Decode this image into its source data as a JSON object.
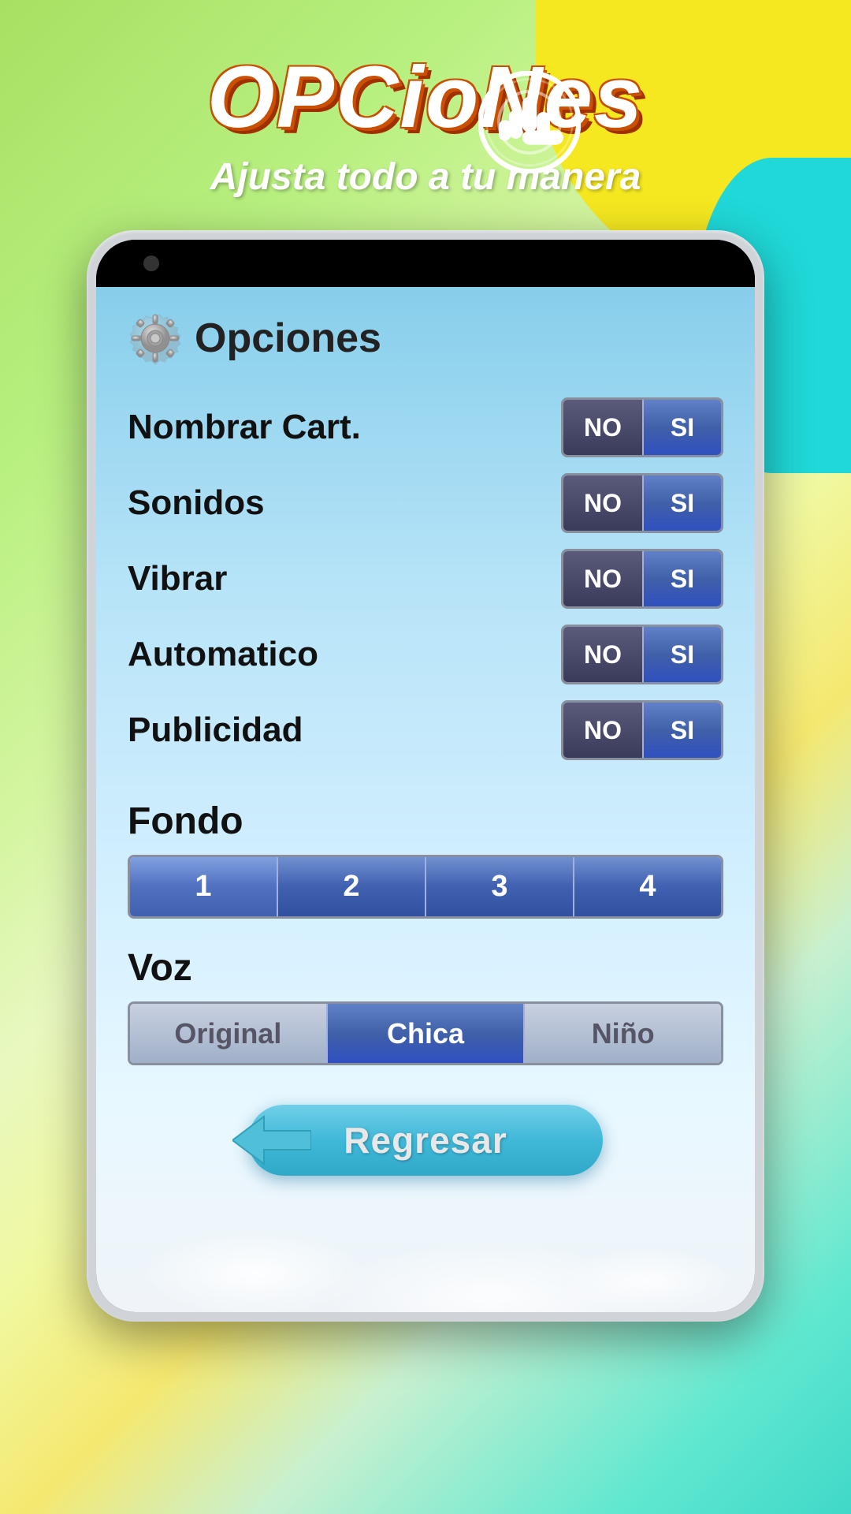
{
  "page": {
    "background": {
      "gradient_start": "#a8e063",
      "gradient_end": "#40d8c8"
    }
  },
  "header": {
    "title": "OPCioNes",
    "subtitle": "Ajusta todo a tu manera",
    "hand_icon_label": "tap-hand"
  },
  "screen": {
    "title": "Opciones",
    "gear_icon": "gear-icon",
    "options": [
      {
        "id": "nombrar_cart",
        "label": "Nombrar Cart.",
        "no_label": "NO",
        "si_label": "SI",
        "selected": "SI"
      },
      {
        "id": "sonidos",
        "label": "Sonidos",
        "no_label": "NO",
        "si_label": "SI",
        "selected": "SI"
      },
      {
        "id": "vibrar",
        "label": "Vibrar",
        "no_label": "NO",
        "si_label": "SI",
        "selected": "SI"
      },
      {
        "id": "automatico",
        "label": "Automatico",
        "no_label": "NO",
        "si_label": "SI",
        "selected": "SI"
      },
      {
        "id": "publicidad",
        "label": "Publicidad",
        "no_label": "NO",
        "si_label": "SI",
        "selected": "SI"
      }
    ],
    "fondo": {
      "label": "Fondo",
      "buttons": [
        "1",
        "2",
        "3",
        "4"
      ],
      "active_index": 0
    },
    "voz": {
      "label": "Voz",
      "buttons": [
        "Original",
        "Chica",
        "Niño"
      ],
      "active_index": 1
    },
    "regresar_label": "Regresar"
  }
}
